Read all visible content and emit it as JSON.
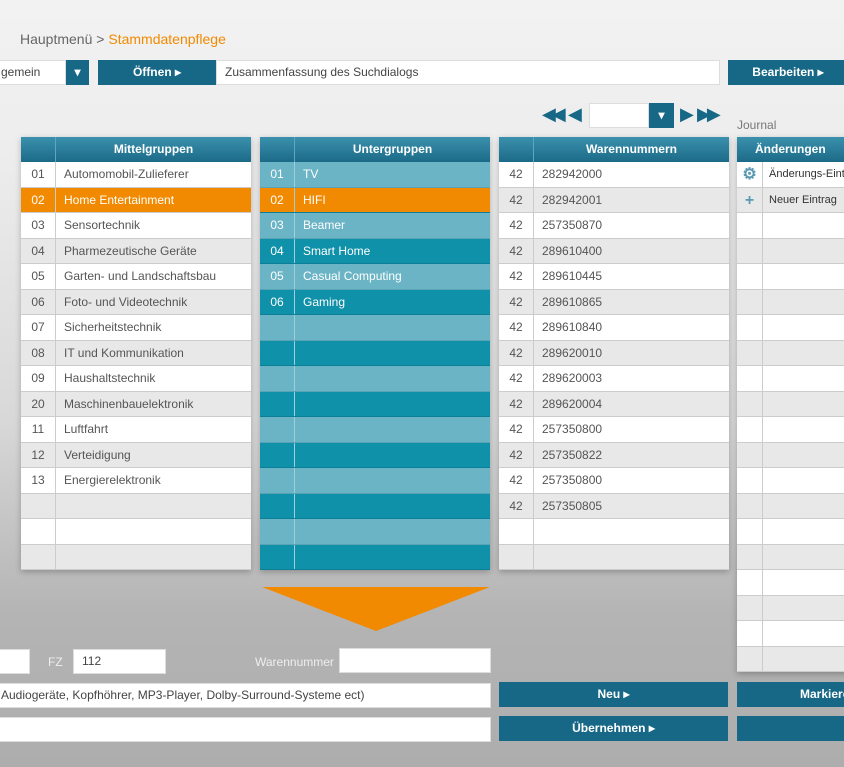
{
  "breadcrumb": {
    "root": "Hauptmenü",
    "separator": " > ",
    "current": "Stammdatenpflege"
  },
  "toolbar": {
    "select_value": "gemein",
    "open_label": "Öffnen",
    "search_summary": "Zusammenfassung des Suchdialogs",
    "edit_label": "Bearbeiten"
  },
  "pager": {
    "value": ""
  },
  "journal_label": "Journal",
  "mittelgruppen": {
    "title": "Mittelgruppen",
    "rows": [
      [
        "01",
        "Automomobil-Zulieferer"
      ],
      [
        "02",
        "Home Entertainment"
      ],
      [
        "03",
        "Sensortechnik"
      ],
      [
        "04",
        "Pharmezeutische Geräte"
      ],
      [
        "05",
        "Garten- und Landschaftsbau"
      ],
      [
        "06",
        "Foto- und Videotechnik"
      ],
      [
        "07",
        "Sicherheitstechnik"
      ],
      [
        "08",
        "IT und Kommunikation"
      ],
      [
        "09",
        "Haushaltstechnik"
      ],
      [
        "20",
        "Maschinenbauelektronik"
      ],
      [
        "11",
        "Luftfahrt"
      ],
      [
        "12",
        "Verteidigung"
      ],
      [
        "13",
        "Energierelektronik"
      ],
      [
        "",
        ""
      ],
      [
        "",
        ""
      ],
      [
        "",
        ""
      ]
    ],
    "selected": 1
  },
  "untergruppen": {
    "title": "Untergruppen",
    "rows": [
      [
        "01",
        "TV"
      ],
      [
        "02",
        "HIFI"
      ],
      [
        "03",
        "Beamer"
      ],
      [
        "04",
        "Smart Home"
      ],
      [
        "05",
        "Casual Computing"
      ],
      [
        "06",
        "Gaming"
      ],
      [
        "",
        ""
      ],
      [
        "",
        ""
      ],
      [
        "",
        ""
      ],
      [
        "",
        ""
      ],
      [
        "",
        ""
      ],
      [
        "",
        ""
      ],
      [
        "",
        ""
      ],
      [
        "",
        ""
      ],
      [
        "",
        ""
      ],
      [
        "",
        ""
      ]
    ],
    "selected": 1
  },
  "warennummern": {
    "title": "Warennummern",
    "rows": [
      [
        "42",
        "282942000"
      ],
      [
        "42",
        "282942001"
      ],
      [
        "42",
        "257350870"
      ],
      [
        "42",
        "289610400"
      ],
      [
        "42",
        "289610445"
      ],
      [
        "42",
        "289610865"
      ],
      [
        "42",
        "289610840"
      ],
      [
        "42",
        "289620010"
      ],
      [
        "42",
        "289620003"
      ],
      [
        "42",
        "289620004"
      ],
      [
        "42",
        "257350800"
      ],
      [
        "42",
        "257350822"
      ],
      [
        "42",
        "257350800"
      ],
      [
        "42",
        "257350805"
      ],
      [
        "",
        ""
      ],
      [
        "",
        ""
      ]
    ]
  },
  "aenderungen": {
    "title": "Änderungen",
    "rows": [
      {
        "icon": "gear-icon",
        "text": "Änderungs-Eintrag"
      },
      {
        "icon": "plus-icon",
        "text": "Neuer Eintrag"
      }
    ]
  },
  "form": {
    "fz_label": "FZ",
    "fz_value": "112",
    "warennummer_label": "Warennummer",
    "warennummer_value": "",
    "description": "Audiogeräte, Kopfhöhrer, MP3-Player, Dolby-Surround-Systeme ect)",
    "line2": ""
  },
  "buttons": {
    "neu": "Neu",
    "uebernehmen": "Übernehmen",
    "markieren": "Markieren",
    "extra": ""
  },
  "colors": {
    "accent": "#f18a00",
    "primary": "#176886"
  }
}
